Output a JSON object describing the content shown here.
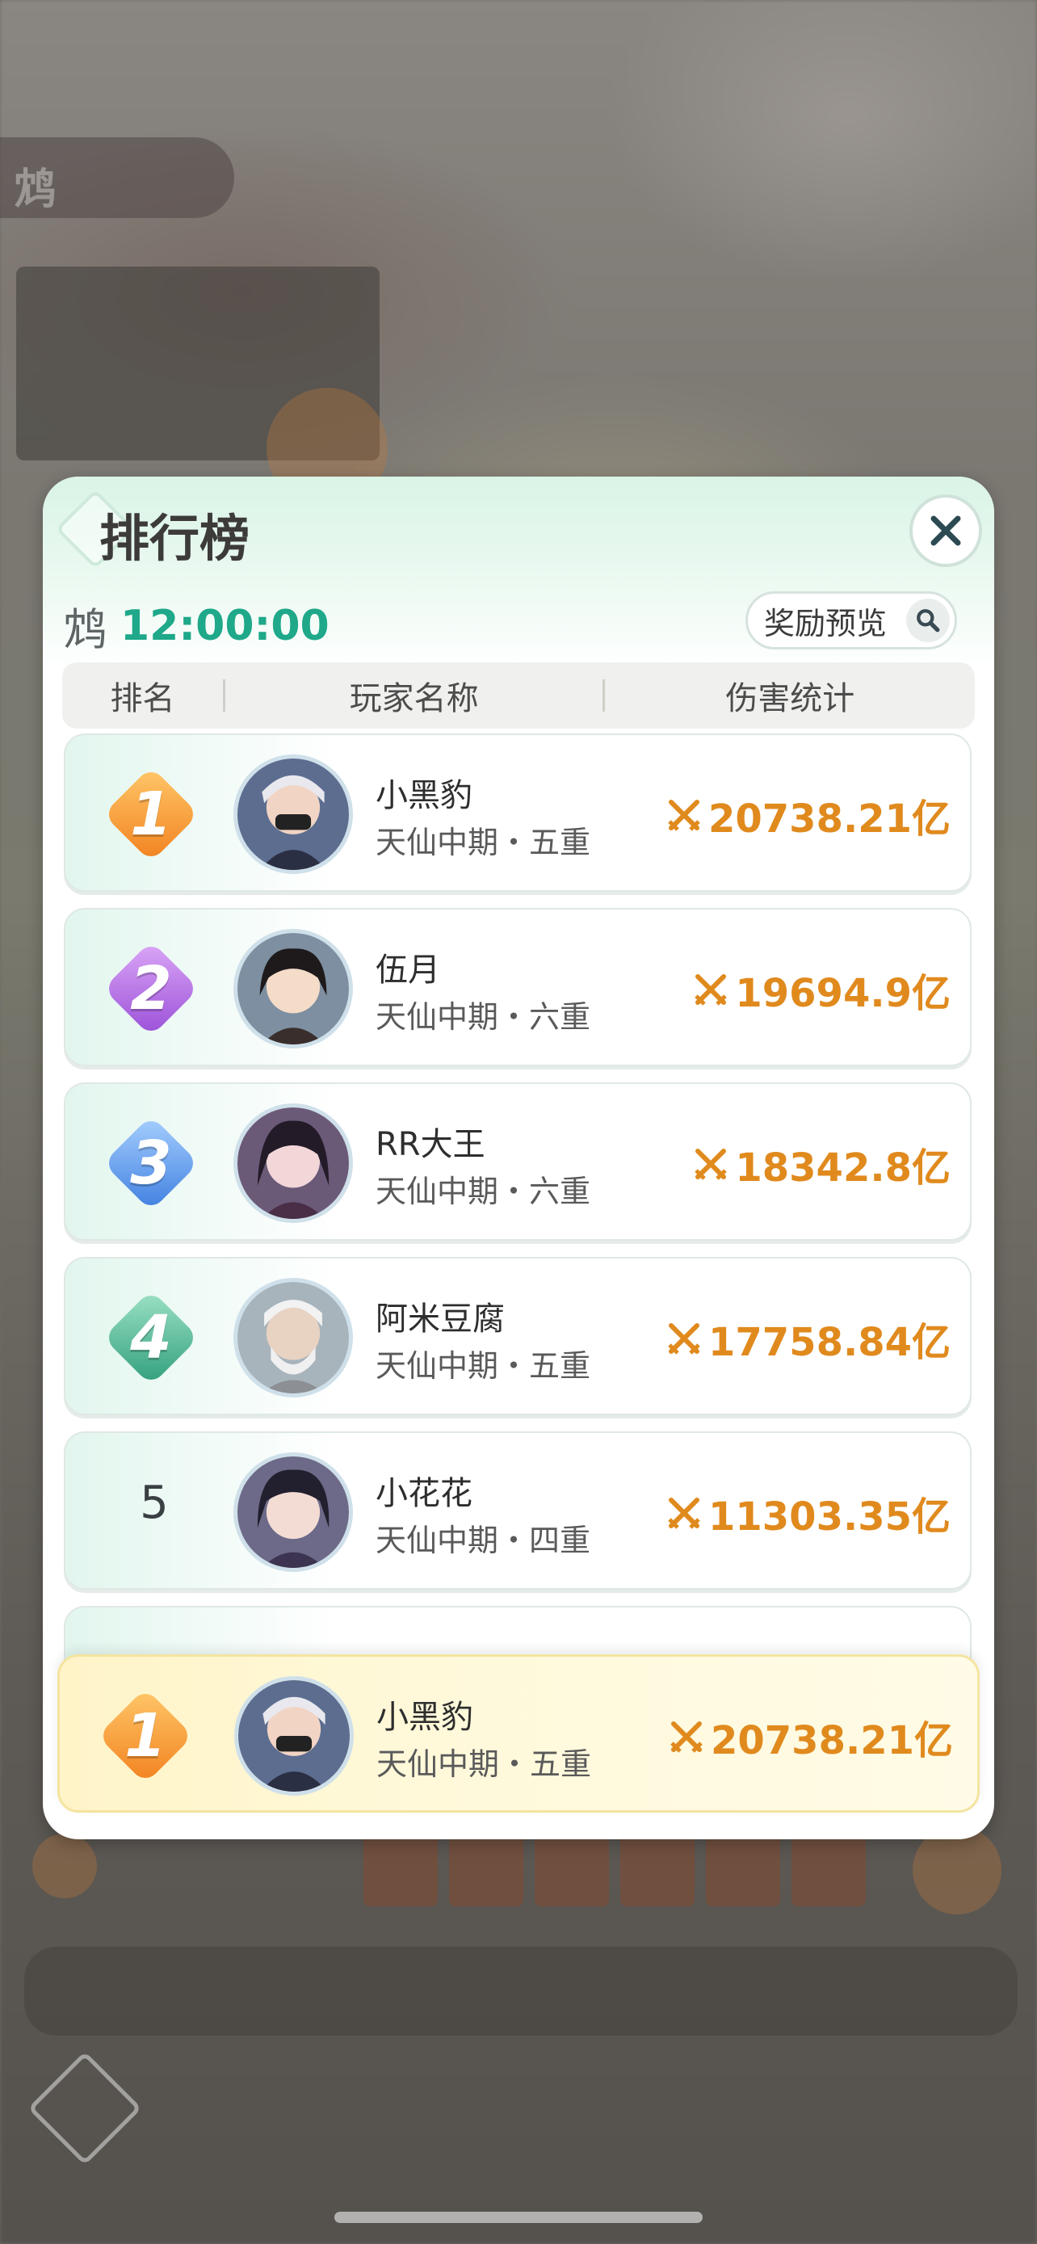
{
  "background": {
    "tab_char": "鸩"
  },
  "modal": {
    "title": "排行榜",
    "countdown_label": "鸩",
    "countdown_time": "12:00:00",
    "reward_button": "奖励预览",
    "columns": [
      "排名",
      "玩家名称",
      "伤害统计"
    ]
  },
  "rows": [
    {
      "rank": "1",
      "name": "小黑豹",
      "realm": "天仙中期・五重",
      "damage": "20738.21亿"
    },
    {
      "rank": "2",
      "name": "伍月",
      "realm": "天仙中期・六重",
      "damage": "19694.9亿"
    },
    {
      "rank": "3",
      "name": "RR大王",
      "realm": "天仙中期・六重",
      "damage": "18342.8亿"
    },
    {
      "rank": "4",
      "name": "阿米豆腐",
      "realm": "天仙中期・五重",
      "damage": "17758.84亿"
    },
    {
      "rank": "5",
      "name": "小花花",
      "realm": "天仙中期・四重",
      "damage": "11303.35亿"
    }
  ],
  "my_rank": {
    "rank": "1",
    "name": "小黑豹",
    "realm": "天仙中期・五重",
    "damage": "20738.21亿"
  },
  "colors": {
    "gold": "#f59a2c",
    "purple": "#b76ae8",
    "blue": "#4f8fe6",
    "green": "#3fb08c",
    "damage": "#e08a1e",
    "accent": "#1fa88a"
  },
  "icons": {
    "close": "close-icon",
    "search": "search-icon",
    "damage": "crossed-swords-icon"
  }
}
